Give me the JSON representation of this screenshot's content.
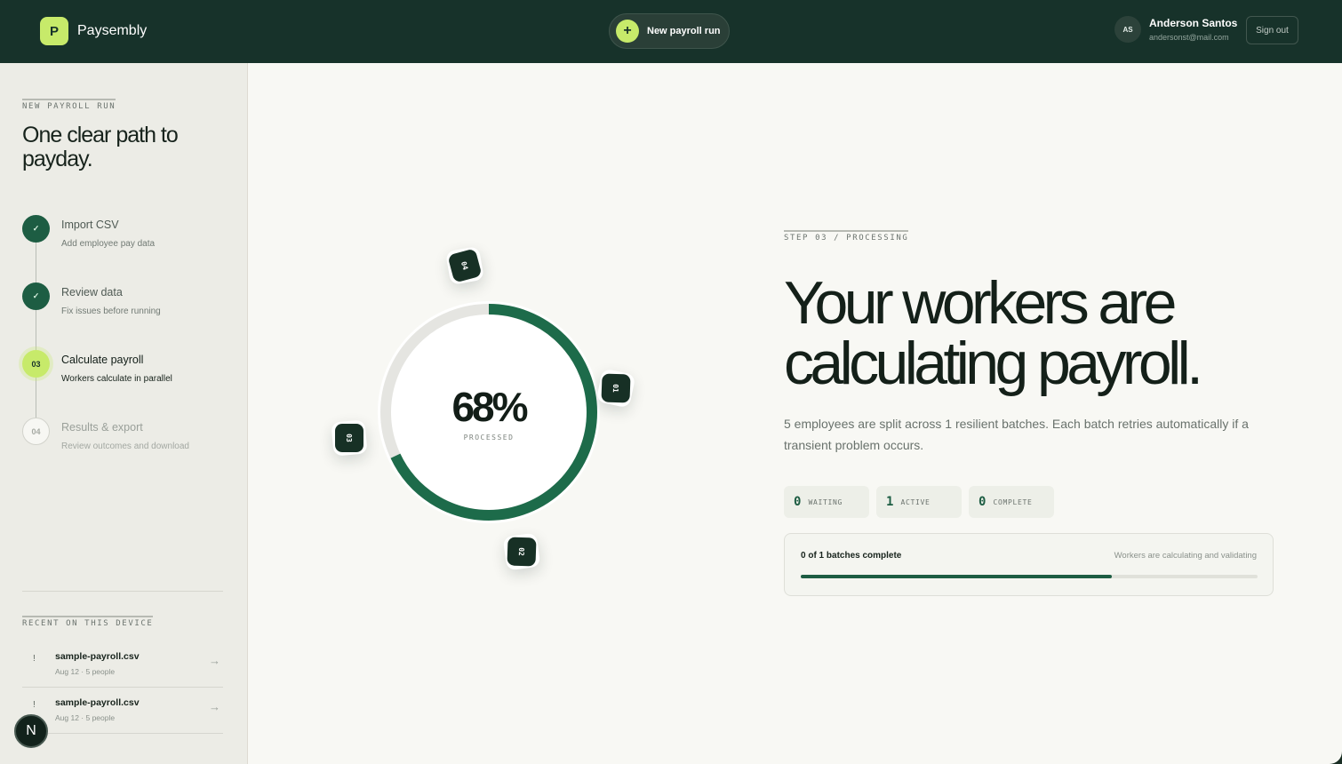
{
  "header": {
    "logo_letter": "P",
    "brand": "Paysembly",
    "new_run_label": "New payroll run",
    "new_run_icon": "plus-icon",
    "user_initials": "AS",
    "user_name": "Anderson Santos",
    "user_email": "andersonst@mail.com",
    "signout_label": "Sign out"
  },
  "sidebar": {
    "eyebrow": "NEW PAYROLL RUN",
    "title": "One clear path to payday.",
    "steps": [
      {
        "marker": "✓",
        "title": "Import CSV",
        "subtitle": "Add employee pay data",
        "state": "done"
      },
      {
        "marker": "✓",
        "title": "Review data",
        "subtitle": "Fix issues before running",
        "state": "done"
      },
      {
        "marker": "03",
        "title": "Calculate payroll",
        "subtitle": "Workers calculate in parallel",
        "state": "current"
      },
      {
        "marker": "04",
        "title": "Results & export",
        "subtitle": "Review outcomes and download",
        "state": "pending"
      }
    ],
    "recent_eyebrow": "RECENT ON THIS DEVICE",
    "recent": [
      {
        "mark": "!",
        "name": "sample-payroll.csv",
        "meta": "Aug 12 · 5 people",
        "arrow": "→"
      },
      {
        "mark": "!",
        "name": "sample-payroll.csv",
        "meta": "Aug 12 · 5 people",
        "arrow": "→"
      }
    ],
    "badge_letter": "N"
  },
  "main": {
    "ring": {
      "value": "68%",
      "fraction": 0.68,
      "label": "PROCESSED",
      "workers": [
        "01",
        "02",
        "03",
        "04"
      ]
    },
    "eyebrow": "STEP 03 / PROCESSING",
    "headline": [
      "Your workers are",
      "calculating payroll."
    ],
    "description": "5 employees are split across 1 resilient batches. Each batch retries automatically if a transient problem occurs.",
    "stats": [
      {
        "value": "0",
        "label": "WAITING"
      },
      {
        "value": "1",
        "label": "ACTIVE"
      },
      {
        "value": "0",
        "label": "COMPLETE"
      }
    ],
    "progress": {
      "label": "0 of 1 batches complete",
      "status": "Workers are calculating and validating",
      "fraction": 0.68
    }
  },
  "colors": {
    "accent": "#1d5d43",
    "lime": "#c7ea6a",
    "dark": "#17322a"
  }
}
